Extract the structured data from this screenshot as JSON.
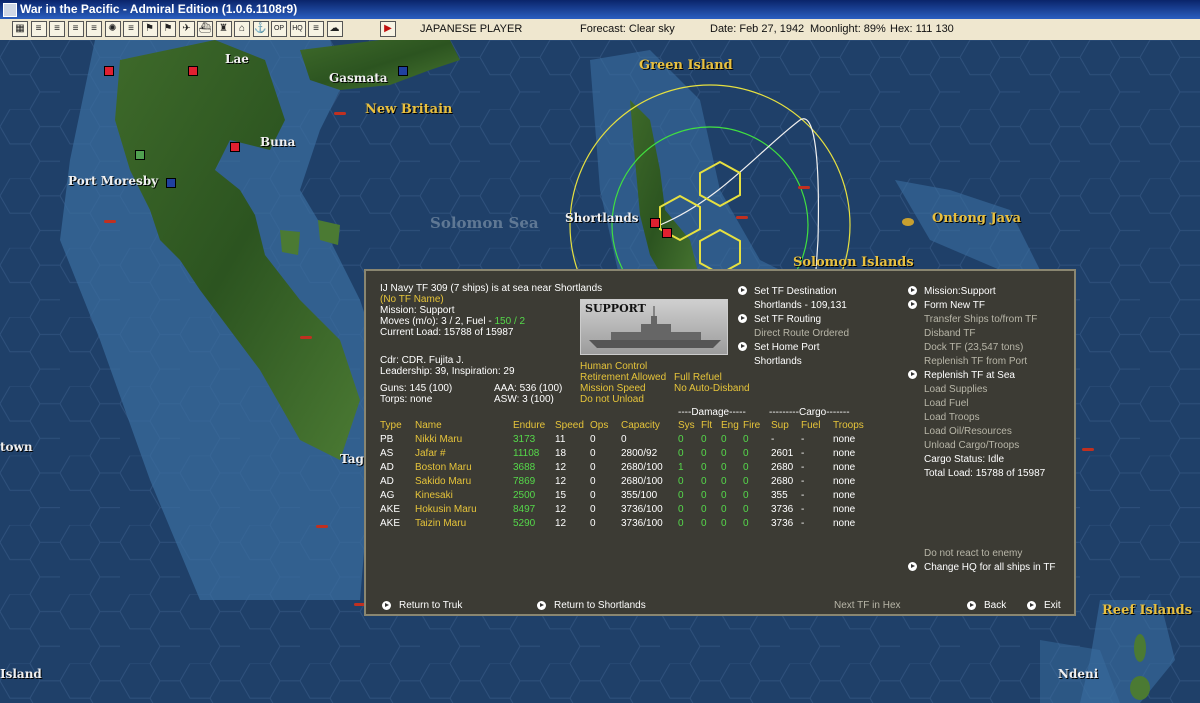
{
  "window": {
    "title": "War in the Pacific - Admiral Edition (1.0.6.1108r9)"
  },
  "toolbar": {
    "player": "JAPANESE PLAYER",
    "forecast": "Forecast: Clear sky",
    "date": "Date: Feb 27, 1942",
    "moonlight": "Moonlight: 89%",
    "hex": "Hex: 111  130",
    "icons": [
      "map-icon",
      "report-icon",
      "report-icon",
      "report-icon",
      "report-icon",
      "rising-sun-flag-icon",
      "report-icon",
      "flag-icon",
      "flag-icon",
      "aircraft-icon",
      "ship-icon",
      "ground-unit-icon",
      "base-icon",
      "fleet-icon",
      "op-icon",
      "hq-icon",
      "report-icon",
      "cloud-icon",
      "end-turn-icon"
    ]
  },
  "map": {
    "labels": [
      {
        "text": "Lae",
        "style": "white"
      },
      {
        "text": "Gasmata",
        "style": "white"
      },
      {
        "text": "Green Island",
        "style": "gold"
      },
      {
        "text": "New Britain",
        "style": "gold"
      },
      {
        "text": "Buna",
        "style": "white"
      },
      {
        "text": "Port Moresby",
        "style": "white"
      },
      {
        "text": "Solomon Sea",
        "style": "sea"
      },
      {
        "text": "Shortlands",
        "style": "white"
      },
      {
        "text": "Ontong Java",
        "style": "gold"
      },
      {
        "text": "Solomon Islands",
        "style": "gold"
      },
      {
        "text": "Tag",
        "style": "white"
      },
      {
        "text": "town",
        "style": "white"
      },
      {
        "text": "Reef Islands",
        "style": "gold"
      },
      {
        "text": "Island",
        "style": "white"
      },
      {
        "text": "Ndeni",
        "style": "white"
      }
    ]
  },
  "tf_panel": {
    "header": "IJ Navy TF 309 (7 ships) is at sea near Shortlands",
    "tf_name": "(No TF Name)",
    "mission": "Mission: Support",
    "moves": "Moves (m/o): 3 / 2, Fuel - ",
    "fuel_value": "150 / 2",
    "current_load": "Current Load: 15788 of 15987",
    "cdr": "Cdr: CDR. Fujita J.",
    "leadership": "Leadership: 39, Inspiration: 29",
    "guns": "Guns: 145 (100)",
    "aaa": "AAA: 536 (100)",
    "torps": "Torps: none",
    "asw": "ASW: 3 (100)",
    "ship_image_label": "SUPPORT",
    "options": {
      "human_control": "Human Control",
      "retirement": "Retirement Allowed",
      "full_refuel": "Full Refuel",
      "mission_speed": "Mission Speed",
      "no_auto_disband": "No Auto-Disband",
      "do_not_unload": "Do not Unload"
    },
    "middle_cmds": {
      "set_destination": "Set TF Destination",
      "destination_value": "Shortlands - 109,131",
      "set_routing": "Set TF Routing",
      "direct_route": "Direct Route Ordered",
      "set_home_port": "Set Home Port",
      "home_port_value": "Shortlands"
    },
    "right_cmds": {
      "mission_support": "Mission:Support",
      "form_new_tf": "Form New TF",
      "transfer_ships": "Transfer Ships to/from TF",
      "disband_tf": "Disband TF",
      "dock_tf": "Dock TF (23,547 tons)",
      "replenish_port": "Replenish TF from Port",
      "replenish_sea": "Replenish TF at Sea",
      "load_supplies": "Load Supplies",
      "load_fuel": "Load Fuel",
      "load_troops": "Load Troops",
      "load_oil": "Load Oil/Resources",
      "unload_cargo": "Unload Cargo/Troops",
      "cargo_status": "Cargo Status: Idle",
      "total_load": "Total Load: 15788 of 15987",
      "no_react": "Do not react to enemy",
      "change_hq": "Change HQ for all ships in TF"
    },
    "group_headers": {
      "damage": "----Damage-----",
      "cargo": "---------Cargo-------"
    },
    "table_headers": [
      "Type",
      "Name",
      "Endure",
      "Speed",
      "Ops",
      "Capacity",
      "Sys",
      "Flt",
      "Eng",
      "Fire",
      "Sup",
      "Fuel",
      "Troops"
    ],
    "ships": [
      {
        "type": "PB",
        "name": "Nikki Maru",
        "endure": "3173",
        "speed": "11",
        "ops": "0",
        "capacity": "0",
        "sys": "0",
        "flt": "0",
        "eng": "0",
        "fire": "0",
        "sup": "-",
        "fuel": "-",
        "troops": "none"
      },
      {
        "type": "AS",
        "name": "Jafar #",
        "endure": "11108",
        "speed": "18",
        "ops": "0",
        "capacity": "2800/92",
        "sys": "0",
        "flt": "0",
        "eng": "0",
        "fire": "0",
        "sup": "2601",
        "fuel": "-",
        "troops": "none"
      },
      {
        "type": "AD",
        "name": "Boston Maru",
        "endure": "3688",
        "speed": "12",
        "ops": "0",
        "capacity": "2680/100",
        "sys": "1",
        "flt": "0",
        "eng": "0",
        "fire": "0",
        "sup": "2680",
        "fuel": "-",
        "troops": "none"
      },
      {
        "type": "AD",
        "name": "Sakido Maru",
        "endure": "7869",
        "speed": "12",
        "ops": "0",
        "capacity": "2680/100",
        "sys": "0",
        "flt": "0",
        "eng": "0",
        "fire": "0",
        "sup": "2680",
        "fuel": "-",
        "troops": "none"
      },
      {
        "type": "AG",
        "name": "Kinesaki",
        "endure": "2500",
        "speed": "15",
        "ops": "0",
        "capacity": "355/100",
        "sys": "0",
        "flt": "0",
        "eng": "0",
        "fire": "0",
        "sup": "355",
        "fuel": "-",
        "troops": "none"
      },
      {
        "type": "AKE",
        "name": "Hokusin Maru",
        "endure": "8497",
        "speed": "12",
        "ops": "0",
        "capacity": "3736/100",
        "sys": "0",
        "flt": "0",
        "eng": "0",
        "fire": "0",
        "sup": "3736",
        "fuel": "-",
        "troops": "none"
      },
      {
        "type": "AKE",
        "name": "Taizin Maru",
        "endure": "5290",
        "speed": "12",
        "ops": "0",
        "capacity": "3736/100",
        "sys": "0",
        "flt": "0",
        "eng": "0",
        "fire": "0",
        "sup": "3736",
        "fuel": "-",
        "troops": "none"
      }
    ],
    "footer": {
      "return_truk": "Return to Truk",
      "return_shortlands": "Return to Shortlands",
      "next_tf": "Next TF in Hex",
      "back": "Back",
      "exit": "Exit"
    }
  }
}
